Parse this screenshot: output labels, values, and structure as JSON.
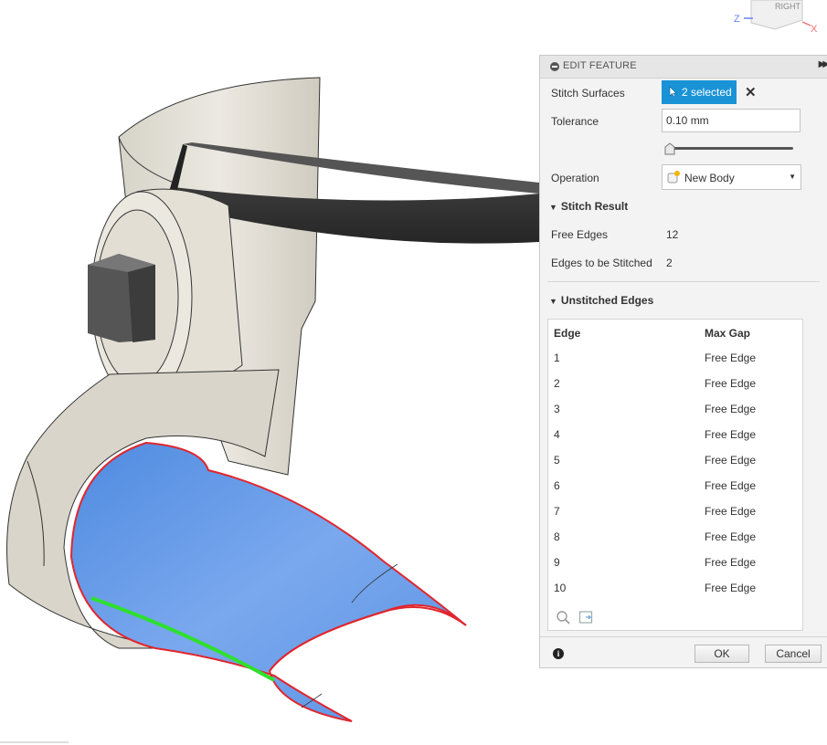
{
  "viewcube": {
    "face_label": "RIGHT",
    "axis_z": "Z",
    "axis_x": "X"
  },
  "panel": {
    "title": "EDIT FEATURE",
    "stitch_surfaces": {
      "label": "Stitch Surfaces",
      "selection": "2 selected"
    },
    "tolerance": {
      "label": "Tolerance",
      "value": "0.10 mm"
    },
    "operation": {
      "label": "Operation",
      "value": "New Body"
    },
    "stitch_result": {
      "title": "Stitch Result",
      "free_edges_label": "Free Edges",
      "free_edges_value": "12",
      "edges_stitched_label": "Edges to be Stitched",
      "edges_stitched_value": "2"
    },
    "unstitched": {
      "title": "Unstitched Edges",
      "columns": [
        "Edge",
        "Max Gap"
      ],
      "rows": [
        {
          "edge": "1",
          "gap": "Free Edge"
        },
        {
          "edge": "2",
          "gap": "Free Edge"
        },
        {
          "edge": "3",
          "gap": "Free Edge"
        },
        {
          "edge": "4",
          "gap": "Free Edge"
        },
        {
          "edge": "5",
          "gap": "Free Edge"
        },
        {
          "edge": "6",
          "gap": "Free Edge"
        },
        {
          "edge": "7",
          "gap": "Free Edge"
        },
        {
          "edge": "8",
          "gap": "Free Edge"
        },
        {
          "edge": "9",
          "gap": "Free Edge"
        },
        {
          "edge": "10",
          "gap": "Free Edge"
        }
      ]
    },
    "ok_label": "OK",
    "cancel_label": "Cancel"
  },
  "colors": {
    "selection_blue": "#1a93d6",
    "surface_blue": "#6b9ee6",
    "edge_red": "#e0262e",
    "edge_green": "#2ee02e"
  }
}
